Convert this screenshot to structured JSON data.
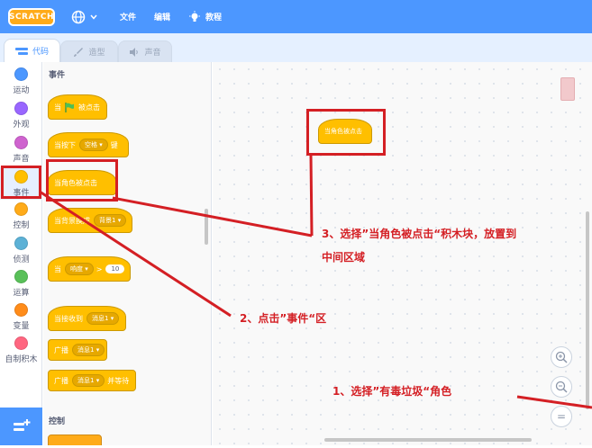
{
  "menubar": {
    "logo_text": "SCRATCH",
    "file_label": "文件",
    "edit_label": "编辑",
    "tutorial_label": "教程",
    "globe_icon": "globe-icon",
    "bulb_icon": "lightbulb-icon"
  },
  "tabs": [
    {
      "label": "代码",
      "icon": "code-icon",
      "active": true
    },
    {
      "label": "造型",
      "icon": "brush-icon",
      "active": false
    },
    {
      "label": "声音",
      "icon": "speaker-icon",
      "active": false
    }
  ],
  "categories": [
    {
      "label": "运动",
      "color": "#4c97ff"
    },
    {
      "label": "外观",
      "color": "#9966ff"
    },
    {
      "label": "声音",
      "color": "#cf63cf"
    },
    {
      "label": "事件",
      "color": "#ffbf00"
    },
    {
      "label": "控制",
      "color": "#ffab19"
    },
    {
      "label": "侦测",
      "color": "#5cb1d6"
    },
    {
      "label": "运算",
      "color": "#59c059"
    },
    {
      "label": "变量",
      "color": "#ff8c1a"
    },
    {
      "label": "自制积木",
      "color": "#ff6680"
    }
  ],
  "palette": {
    "section_events": "事件",
    "section_control": "控制",
    "blocks": {
      "when_flag": {
        "pre": "当",
        "post": "被点击"
      },
      "when_key": {
        "pre": "当按下",
        "dropdown": "空格",
        "post": "键"
      },
      "when_sprite_clicked": "当角色被点击",
      "when_backdrop": {
        "pre": "当背景换成",
        "dropdown": "背景1"
      },
      "when_greater": {
        "pre": "当",
        "dropdown": "响度",
        "op": ">",
        "value": "10"
      },
      "when_receive": {
        "pre": "当接收到",
        "dropdown": "消息1"
      },
      "broadcast": {
        "pre": "广播",
        "dropdown": "消息1"
      },
      "broadcast_wait": {
        "pre": "广播",
        "dropdown": "消息1",
        "post": "并等待"
      }
    }
  },
  "script": {
    "placed_block": "当角色被点击"
  },
  "zoom": {
    "in": "+",
    "out": "−",
    "reset": "="
  },
  "annotations": {
    "step1": "1、选择”有毒垃圾“角色",
    "step2": "2、点击”事件“区",
    "step3_line1": "3、选择”当角色被点击“积木块，放置到",
    "step3_line2": "中间区域"
  },
  "colors": {
    "menubar": "#4c97ff",
    "events_block": "#ffbf00",
    "annotation": "#d41f24"
  }
}
